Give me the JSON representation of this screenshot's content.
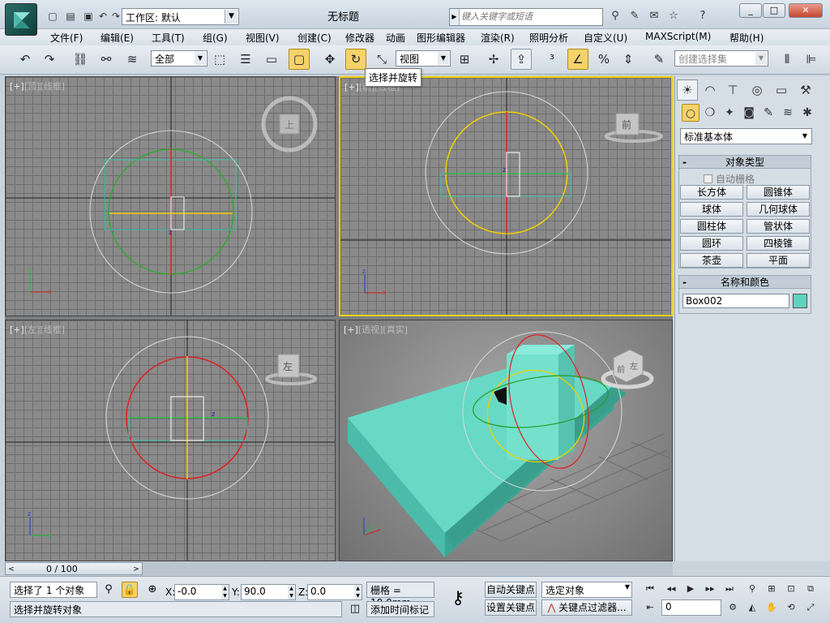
{
  "titlebar": {
    "workspace_label": "工作区: 默认",
    "window_title": "无标题",
    "search_placeholder": "键入关键字或短语"
  },
  "menu": [
    "文件(F)",
    "编辑(E)",
    "工具(T)",
    "组(G)",
    "视图(V)",
    "创建(C)",
    "修改器",
    "动画",
    "图形编辑器",
    "渲染(R)",
    "照明分析",
    "自定义(U)",
    "MAXScript(M)",
    "帮助(H)"
  ],
  "toolbar": {
    "selection_filter": "全部",
    "ref_coord": "视图",
    "named_selection_placeholder": "创建选择集",
    "tooltip": "选择并旋转"
  },
  "viewports": {
    "top": {
      "bracket": "[+]",
      "name": "[顶]",
      "mode": "[线框]",
      "cube_label": "上"
    },
    "front": {
      "bracket": "[+]",
      "name": "[前]",
      "mode": "[线框]",
      "cube_label": "前"
    },
    "left": {
      "bracket": "[+]",
      "name": "[左]",
      "mode": "[线框]",
      "cube_label": "左"
    },
    "persp": {
      "bracket": "[+]",
      "name": "[透视]",
      "mode": "[真实]",
      "cube_label_a": "前",
      "cube_label_b": "左"
    }
  },
  "command_panel": {
    "category": "标准基本体",
    "object_type_title": "对象类型",
    "autogrid_label": "自动栅格",
    "buttons": [
      "长方体",
      "圆锥体",
      "球体",
      "几何球体",
      "圆柱体",
      "管状体",
      "圆环",
      "四棱锥",
      "茶壶",
      "平面"
    ],
    "name_color_title": "名称和颜色",
    "object_name": "Box002",
    "object_color": "#5fd3c0"
  },
  "timeline": {
    "frame_display": "0 / 100"
  },
  "status": {
    "selection_info": "选择了 1 个对象",
    "prompt": "选择并旋转对象",
    "x_value": "-0.0",
    "y_value": "90.0",
    "z_value": "0.0",
    "grid_label": "栅格 = 10.0mm",
    "auto_key": "自动关键点",
    "set_key": "设置关键点",
    "key_mode": "选定对象",
    "key_filters": "关键点过滤器...",
    "add_time_tag": "添加时间标记",
    "current_frame": "0"
  },
  "colors": {
    "active_viewport_border": "#f0d000",
    "box_color": "#5fd3c0",
    "gizmo_x": "#ff2020",
    "gizmo_y": "#ffe000",
    "gizmo_z": "#20c040"
  }
}
